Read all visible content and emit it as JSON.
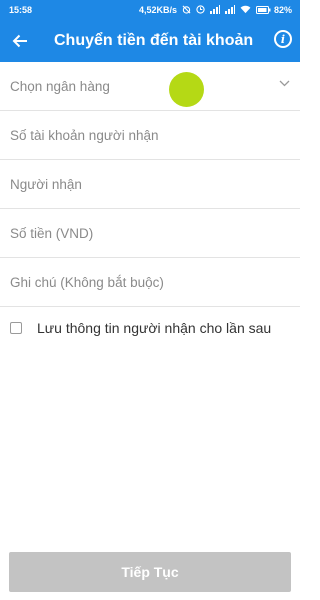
{
  "status_bar": {
    "time": "15:58",
    "net_speed": "4,52KB/s",
    "battery": "82%",
    "icons": [
      "alarm-off-icon",
      "clock-icon",
      "signal-icon",
      "signal-icon",
      "wifi-icon",
      "battery-icon"
    ]
  },
  "header": {
    "title": "Chuyển tiền đến tài khoản",
    "back_icon": "arrow-left-icon",
    "info_icon": "info-icon",
    "info_glyph": "i"
  },
  "form": {
    "bank_select": {
      "placeholder": "Chọn ngân hàng",
      "icon": "chevron-down-icon"
    },
    "account_number": {
      "placeholder": "Số tài khoản người nhận"
    },
    "recipient": {
      "placeholder": "Người nhận"
    },
    "amount": {
      "placeholder": "Số tiền (VND)"
    },
    "note": {
      "placeholder": "Ghi chú (Không bắt buộc)"
    },
    "save_checkbox": {
      "label": "Lưu thông tin người nhận cho lần sau",
      "checked": false
    }
  },
  "footer": {
    "continue_label": "Tiếp Tục"
  },
  "colors": {
    "primary": "#1e88e5",
    "button_disabled": "#c3c3c3",
    "placeholder": "#8a8a8a",
    "touch_indicator": "#b5d915"
  }
}
